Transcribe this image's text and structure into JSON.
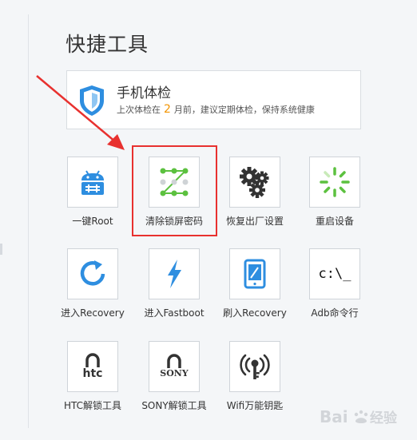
{
  "title": "快捷工具",
  "checkup": {
    "title": "手机体检",
    "subtitle_pre": "上次体检在",
    "months": "2",
    "subtitle_post": "月前，建议定期体检，保持系统健康"
  },
  "tools": [
    {
      "label": "一键Root",
      "icon": "android-root-icon"
    },
    {
      "label": "清除锁屏密码",
      "icon": "pattern-lock-icon"
    },
    {
      "label": "恢复出厂设置",
      "icon": "gears-icon"
    },
    {
      "label": "重启设备",
      "icon": "restart-spinner-icon"
    },
    {
      "label": "进入Recovery",
      "icon": "refresh-icon"
    },
    {
      "label": "进入Fastboot",
      "icon": "lightning-icon"
    },
    {
      "label": "刷入Recovery",
      "icon": "tablet-pen-icon"
    },
    {
      "label": "Adb命令行",
      "icon": "terminal-icon"
    },
    {
      "label": "HTC解锁工具",
      "icon": "htc-unlock-icon"
    },
    {
      "label": "SONY解锁工具",
      "icon": "sony-unlock-icon"
    },
    {
      "label": "Wifi万能钥匙",
      "icon": "wifi-key-icon"
    }
  ],
  "terminal_text": "c:\\_",
  "htc_text": "htc",
  "sony_text": "SONY",
  "colors": {
    "accent_blue": "#2e8ee0",
    "green": "#5cc13f",
    "highlight_red": "#e8312f",
    "orange": "#f29400"
  }
}
